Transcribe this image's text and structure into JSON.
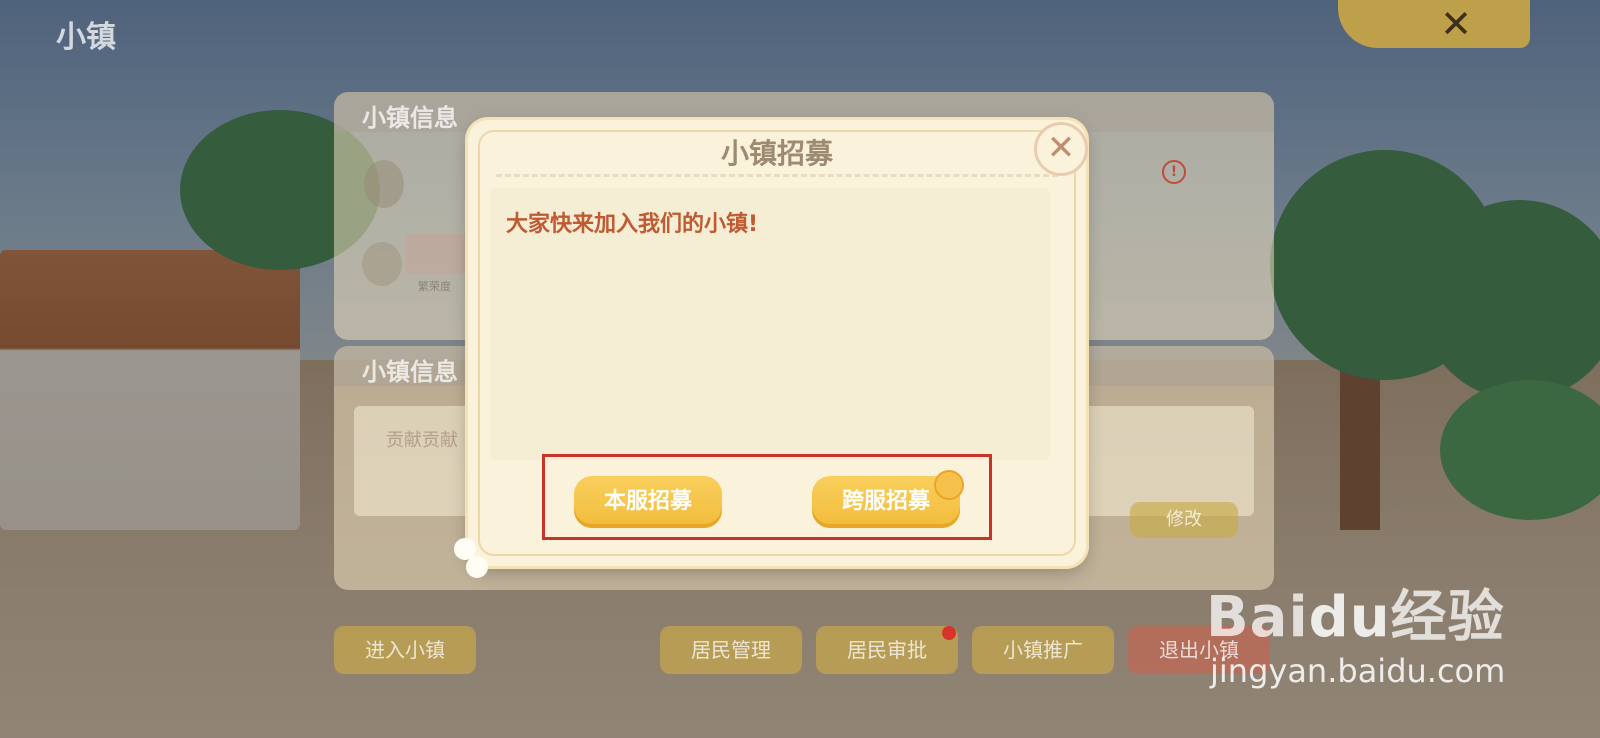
{
  "game_title": "小镇",
  "top_close_icon": "close-icon",
  "info_panel": {
    "title": "小镇信息",
    "tiny_label": "繁荣度"
  },
  "notice_panel": {
    "title": "小镇信息",
    "notice_text": "贡献贡献",
    "edit_label": "修改"
  },
  "bottom_buttons": {
    "enter_town": "进入小镇",
    "resident_manage": "居民管理",
    "resident_approve": "居民审批",
    "town_promote": "小镇推广",
    "exit_town": "退出小镇"
  },
  "dialog": {
    "title": "小镇招募",
    "message": "大家快来加入我们的小镇!",
    "local_recruit": "本服招募",
    "cross_recruit": "跨服招募",
    "close_icon": "close-icon"
  },
  "watermark": {
    "logo_bai": "Bai",
    "logo_du": "du",
    "logo_cn": "经验",
    "url": "jingyan.baidu.com"
  },
  "colors": {
    "highlight": "#c8322b",
    "button": "#f2bc3b",
    "message": "#c05a32"
  }
}
